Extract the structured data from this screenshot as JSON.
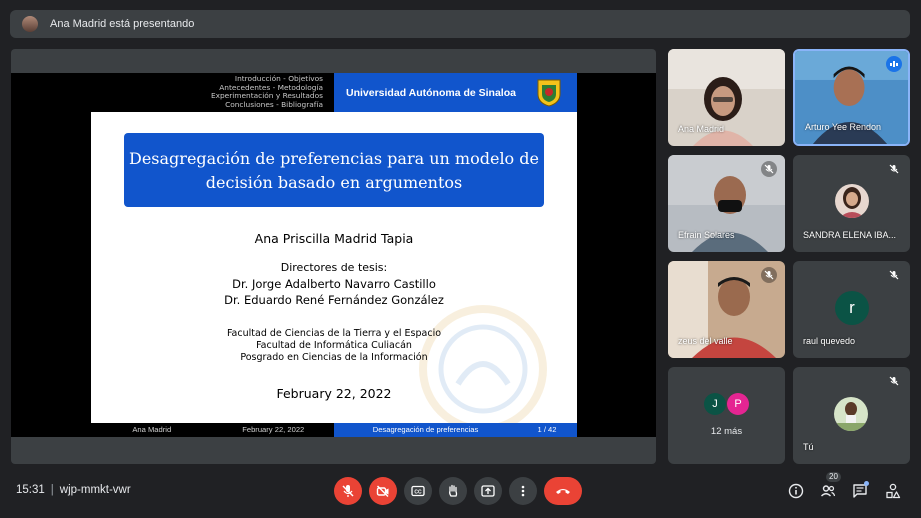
{
  "presenter_bar": {
    "text": "Ana Madrid está presentando"
  },
  "slide": {
    "nav": [
      "Introducción - Objetivos",
      "Antecedentes - Metodología",
      "Experimentación y Resultados",
      "Conclusiones - Bibliografía"
    ],
    "university": "Universidad Autónoma de Sinaloa",
    "title_line1": "Desagregación de preferencias para un modelo de",
    "title_line2": "decisión basado en argumentos",
    "author": "Ana Priscilla Madrid Tapia",
    "directors_heading": "Directores de tesis:",
    "director1": "Dr. Jorge Adalberto Navarro Castillo",
    "director2": "Dr. Eduardo René Fernández González",
    "faculty1": "Facultad de Ciencias de la Tierra y el Espacio",
    "faculty2": "Facultad de Informática Culiacán",
    "faculty3": "Posgrado en Ciencias de la Información",
    "date": "February 22, 2022",
    "footer": {
      "author": "Ana Madrid",
      "date": "February 22, 2022",
      "title": "Desagregación de preferencias",
      "page": "1 / 42"
    }
  },
  "participants": [
    {
      "name": "Ana Madrid",
      "muted": false
    },
    {
      "name": "Arturo Yee Rendon",
      "speaking": true
    },
    {
      "name": "Efrain Solares",
      "muted": true
    },
    {
      "name": "SANDRA ELENA IBA...",
      "muted": true
    },
    {
      "name": "zeus del valle",
      "muted": true
    },
    {
      "name": "raul quevedo",
      "muted": true,
      "initial": "r"
    },
    {
      "more_initials": [
        "J",
        "P"
      ],
      "more_label": "12 más"
    },
    {
      "name": "Tú",
      "muted": true
    }
  ],
  "bottom_bar": {
    "time": "15:31",
    "meeting_code": "wjp-mmkt-vwr",
    "participant_count": "20"
  },
  "colors": {
    "beamer_blue": "#1155cc",
    "red": "#ea4335",
    "active_border": "#8ab4f8",
    "raul_avatar": "#0b5345",
    "j_avatar": "#0b5345",
    "p_avatar": "#e52592"
  },
  "icons": [
    "mic-off-icon",
    "camera-off-icon",
    "captions-icon",
    "raise-hand-icon",
    "present-icon",
    "more-options-icon",
    "end-call-icon",
    "info-icon",
    "people-icon",
    "chat-icon",
    "activities-icon",
    "speaking-icon"
  ]
}
